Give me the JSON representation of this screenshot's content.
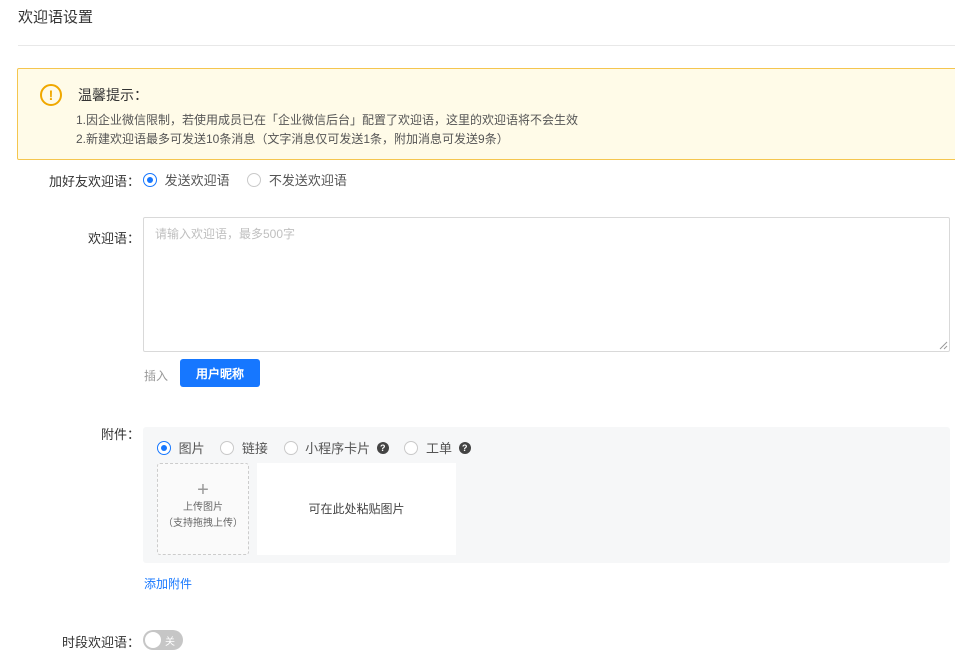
{
  "page": {
    "title": "欢迎语设置"
  },
  "notice": {
    "title": "温馨提示：",
    "lines": [
      "1.因企业微信限制，若使用成员已在「企业微信后台」配置了欢迎语，这里的欢迎语将不会生效",
      "2.新建欢迎语最多可发送10条消息（文字消息仅可发送1条，附加消息可发送9条）"
    ]
  },
  "friend_greeting": {
    "label": "加好友欢迎语：",
    "options": [
      {
        "label": "发送欢迎语",
        "checked": true
      },
      {
        "label": "不发送欢迎语",
        "checked": false
      }
    ]
  },
  "greeting": {
    "label": "欢迎语：",
    "value": "",
    "placeholder": "请输入欢迎语，最多500字",
    "insert_label": "插入",
    "nickname_button": "用户昵称"
  },
  "attachment": {
    "label": "附件：",
    "types": [
      {
        "label": "图片",
        "checked": true,
        "help": false
      },
      {
        "label": "链接",
        "checked": false,
        "help": false
      },
      {
        "label": "小程序卡片",
        "checked": false,
        "help": true
      },
      {
        "label": "工单",
        "checked": false,
        "help": true
      }
    ],
    "upload_plus": "+",
    "upload_line1": "上传图片",
    "upload_line2": "（支持拖拽上传）",
    "paste_text": "可在此处粘贴图片",
    "add_link": "添加附件"
  },
  "period_greeting": {
    "label": "时段欢迎语：",
    "toggle_text": "关",
    "enabled": false
  },
  "colors": {
    "primary": "#1677ff",
    "notice_bg": "#fffbe8",
    "notice_border": "#f5c64f",
    "warning": "#f0a800"
  }
}
